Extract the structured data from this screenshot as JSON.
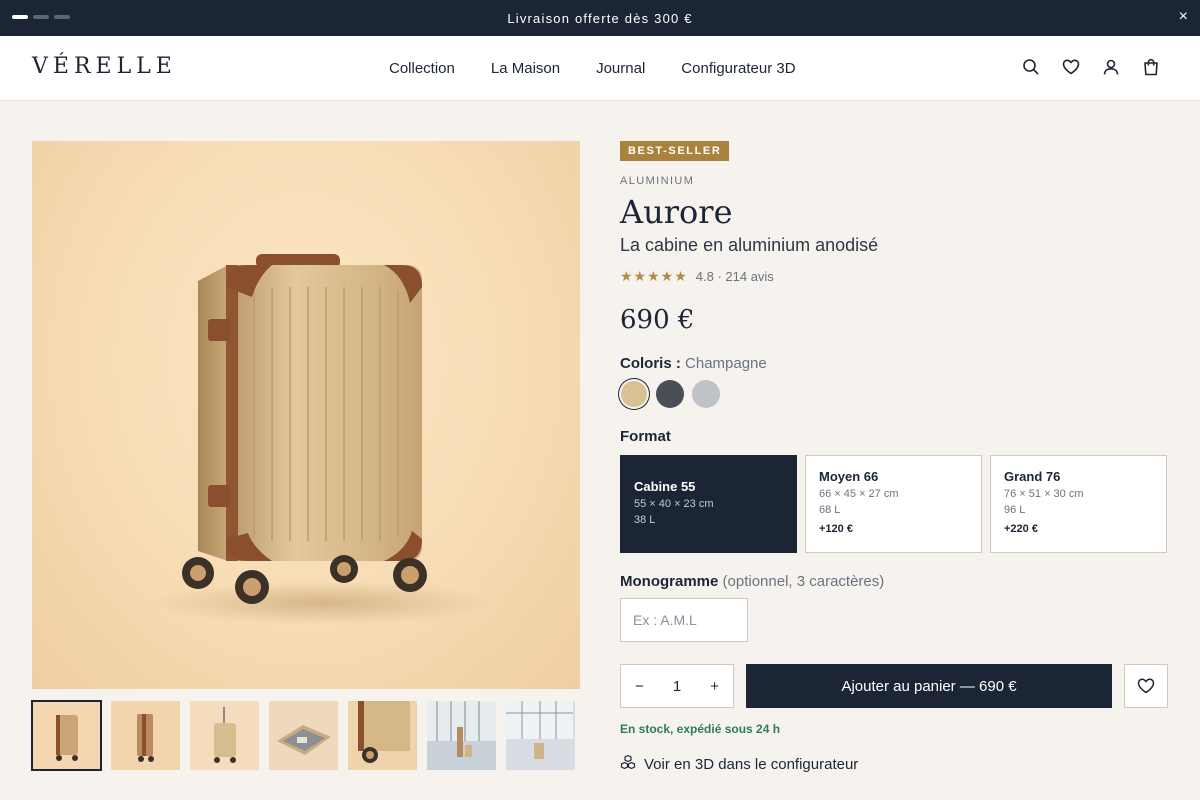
{
  "announcement": {
    "text": "Livraison offerte dès 300 €",
    "close": "×"
  },
  "brand": {
    "logo": "VÉRELLE"
  },
  "nav": {
    "items": [
      "Collection",
      "La Maison",
      "Journal",
      "Configurateur 3D"
    ]
  },
  "header_icons": [
    "search-icon",
    "heart-icon",
    "user-icon",
    "bag-icon"
  ],
  "gallery": {
    "main_image": "champagne-aluminium-carry-on-suitcase",
    "thumbnails": [
      "front-view",
      "side-view",
      "handle-extended",
      "open-interior",
      "wheel-detail",
      "airport-traveler",
      "airport-terminal"
    ]
  },
  "product": {
    "badge": "BEST-SELLER",
    "category": "ALUMINIUM",
    "title": "Aurore",
    "subtitle": "La cabine en aluminium anodisé",
    "rating_stars": "★★★★★",
    "rating_text": "4.8 · 214 avis",
    "price": "690 €"
  },
  "colors": {
    "label": "Coloris :",
    "selected": "Champagne",
    "swatches": [
      "#d9c195",
      "#4a4e57",
      "#bfc2c7"
    ]
  },
  "format": {
    "label": "Format",
    "options": [
      {
        "name": "Cabine 55",
        "dimensions": "55 × 40 × 23 cm",
        "volume": "38 L",
        "price": ""
      },
      {
        "name": "Moyen 66",
        "dimensions": "66 × 45 × 27 cm",
        "volume": "68 L",
        "price": "+120 €"
      },
      {
        "name": "Grand 76",
        "dimensions": "76 × 51 × 30 cm",
        "volume": "96 L",
        "price": "+220 €"
      }
    ]
  },
  "monogram": {
    "label": "Monogramme",
    "hint": "(optionnel, 3 caractères)",
    "placeholder": "Ex : A.M.L",
    "value": ""
  },
  "cart": {
    "qty_minus": "−",
    "quantity": "1",
    "qty_plus": "+",
    "add_label": "Ajouter au panier — 690 €"
  },
  "stock": "En stock, expédié sous 24 h",
  "view3d": "Voir en 3D dans le configurateur",
  "colors_theme": {
    "navy": "#1c2536",
    "gold": "#a9823d",
    "stock_green": "#2f7d4f",
    "background": "#f6f3ee"
  }
}
